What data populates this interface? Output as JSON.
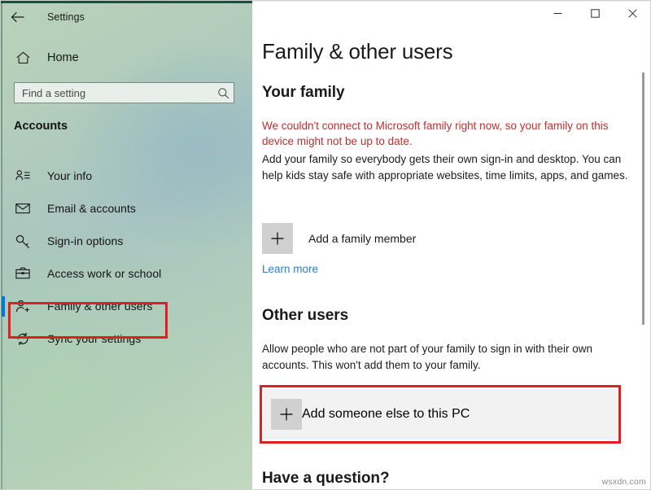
{
  "window": {
    "title": "Settings",
    "back_icon": "back-arrow-icon",
    "controls": {
      "minimize": "minimize-icon",
      "maximize": "maximize-icon",
      "close": "close-icon"
    }
  },
  "sidebar": {
    "home_label": "Home",
    "home_icon": "home-icon",
    "search": {
      "placeholder": "Find a setting",
      "value": "",
      "icon": "search-icon"
    },
    "section_title": "Accounts",
    "items": [
      {
        "label": "Your info",
        "icon": "person-info-icon",
        "selected": false
      },
      {
        "label": "Email & accounts",
        "icon": "envelope-icon",
        "selected": false
      },
      {
        "label": "Sign-in options",
        "icon": "key-icon",
        "selected": false
      },
      {
        "label": "Access work or school",
        "icon": "briefcase-icon",
        "selected": false
      },
      {
        "label": "Family & other users",
        "icon": "person-add-icon",
        "selected": true
      },
      {
        "label": "Sync your settings",
        "icon": "sync-icon",
        "selected": false
      }
    ]
  },
  "main": {
    "page_title": "Family & other users",
    "your_family": {
      "heading": "Your family",
      "error_text": "We couldn't connect to Microsoft family right now, so your family on this device might not be up to date.",
      "description": "Add your family so everybody gets their own sign-in and desktop. You can help kids stay safe with appropriate websites, time limits, apps, and games.",
      "add_button_label": "Add a family member",
      "add_button_icon": "plus-icon",
      "learn_more_label": "Learn more"
    },
    "other_users": {
      "heading": "Other users",
      "description": "Allow people who are not part of your family to sign in with their own accounts. This won't add them to your family.",
      "add_button_label": "Add someone else to this PC",
      "add_button_icon": "plus-icon"
    },
    "have_question": {
      "heading": "Have a question?"
    }
  },
  "annotations": {
    "highlight_color": "#e02020",
    "targets": [
      "Family & other users",
      "Add someone else to this PC"
    ]
  },
  "watermark": "wsxdn.com",
  "colors": {
    "accent": "#0078d7",
    "error_text": "#bc3030",
    "link": "#2a7fc9",
    "tile": "#d0d0d0",
    "row_hover": "#f2f2f2"
  }
}
